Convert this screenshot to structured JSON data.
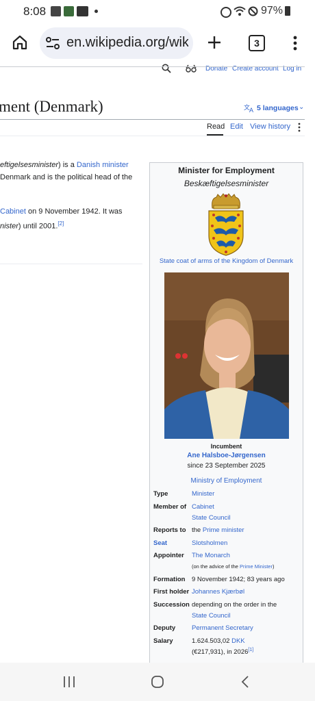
{
  "status": {
    "time": "8:08",
    "battery": "97%"
  },
  "browser": {
    "url": "en.wikipedia.org/wik",
    "tab_count": "3"
  },
  "wiki_header": {
    "links": [
      "Donate",
      "Create account",
      "Log in"
    ]
  },
  "article": {
    "title": "ment (Denmark)",
    "languages": "5 languages",
    "tabs": [
      "Read",
      "Edit",
      "View history"
    ],
    "lead": {
      "line1_pre": "eftigelsesminister",
      "line1_mid": ") is a ",
      "line1_link": "Danish minister",
      "line2": "Denmark and is the political head of the",
      "line3_link": "Cabinet",
      "line3_rest": " on 9 November 1942. It was",
      "line4_pre": "nister",
      "line4_rest": ") until 2001.",
      "line4_ref": "[2]"
    }
  },
  "infobox": {
    "title": "Minister for Employment",
    "subtitle": "Beskæftigelsesminister",
    "emblem_caption": "State coat of arms of the Kingdom of Denmark",
    "incumbent_label": "Incumbent",
    "incumbent_name": "Ane Halsboe-Jørgensen",
    "incumbent_since": "since 23 September 2025",
    "ministry": "Ministry of Employment",
    "rows": {
      "type_label": "Type",
      "type_value": "Minister",
      "member_label": "Member of",
      "member_value1": "Cabinet",
      "member_value2": "State Council",
      "reports_label": "Reports to",
      "reports_pre": "the ",
      "reports_link": "Prime minister",
      "seat_label": "Seat",
      "seat_value": "Slotsholmen",
      "appointer_label": "Appointer",
      "appointer_value": "The Monarch",
      "appointer_note_pre": "(on the advice of the ",
      "appointer_note_link": "Prime Minister",
      "appointer_note_post": ")",
      "formation_label": "Formation",
      "formation_value": "9 November 1942; 83 years ago",
      "first_label": "First holder",
      "first_value": "Johannes Kjærbøl",
      "succession_label": "Succession",
      "succession_value1": "depending on the order in the",
      "succession_value2": "State Council",
      "deputy_label": "Deputy",
      "deputy_value": "Permanent Secretary",
      "salary_label": "Salary",
      "salary_value1_pre": "1.624.503,02 ",
      "salary_value1_link": "DKK",
      "salary_value2": "(€217,931), in 2026",
      "salary_ref": "[1]"
    }
  },
  "colors": {
    "link": "#3366cc",
    "text": "#202122",
    "infobox_bg": "#f8f9fa"
  }
}
